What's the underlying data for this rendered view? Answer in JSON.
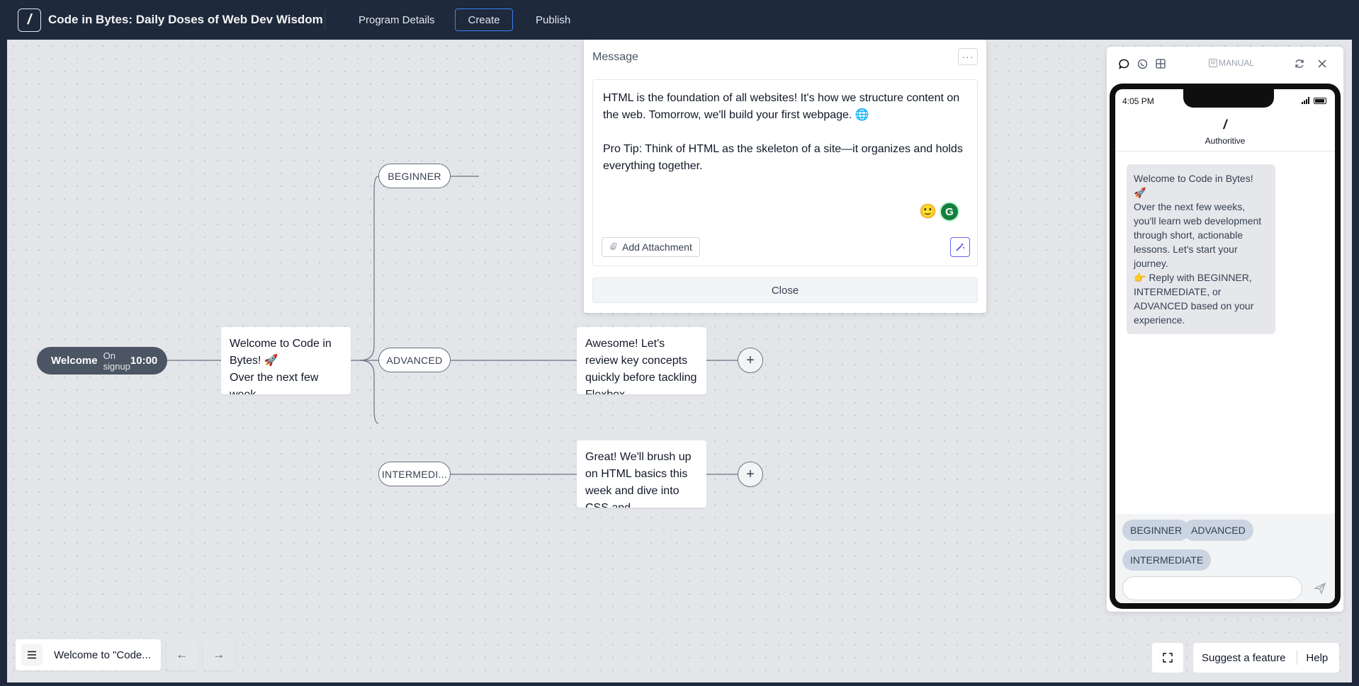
{
  "app": {
    "logo_glyph": "/",
    "title": "Code in Bytes: Daily Doses of Web Dev Wisdom"
  },
  "top_tabs": [
    {
      "label": "Program Details",
      "active": false
    },
    {
      "label": "Create",
      "active": true
    },
    {
      "label": "Publish",
      "active": false
    }
  ],
  "trigger": {
    "name": "Welcome",
    "subtitle": "On signup",
    "time": "10:00"
  },
  "flow": {
    "welcome_node": "Welcome to Code in Bytes! 🚀\nOver the next few week...",
    "branches": [
      {
        "label": "BEGINNER",
        "message": ""
      },
      {
        "label": "ADVANCED",
        "message": "Awesome! Let's review key concepts quickly before tackling Flexbox, ..."
      },
      {
        "label": "INTERMEDI...",
        "message": "Great! We'll brush up on HTML basics this week and dive into CSS and ..."
      }
    ],
    "add_glyph": "+"
  },
  "editor": {
    "title": "Message",
    "menu_glyph": "···",
    "paragraphs": [
      "HTML is the foundation of all websites! It's how we structure content on the web. Tomorrow, we'll build your first webpage. 🌐",
      "Pro Tip: Think of HTML as the skeleton of a site—it organizes and holds everything together."
    ],
    "emoji": "🙂",
    "grammarly_glyph": "G",
    "attach_label": "Add Attachment",
    "close_label": "Close"
  },
  "preview": {
    "mode_label": "MANUAL",
    "status_time": "4:05 PM",
    "sender_name": "Authoritive",
    "bubble_text": "Welcome to Code in Bytes!\n🚀\nOver the next few weeks, you'll learn web development through short, actionable lessons. Let's start your journey.\n👉 Reply with BEGINNER, INTERMEDIATE, or ADVANCED based on your experience.",
    "quick_replies": [
      "BEGINNER",
      "ADVANCED",
      "INTERMEDIATE"
    ],
    "input_placeholder": ""
  },
  "bottom": {
    "breadcrumb": "Welcome to \"Code...",
    "prev_glyph": "←",
    "next_glyph": "→",
    "suggest_label": "Suggest a feature",
    "help_label": "Help"
  },
  "colors": {
    "topbar": "#1e293b",
    "accent": "#3b82f6",
    "canvas": "#e3e5e9",
    "trigger": "#4b5563"
  }
}
